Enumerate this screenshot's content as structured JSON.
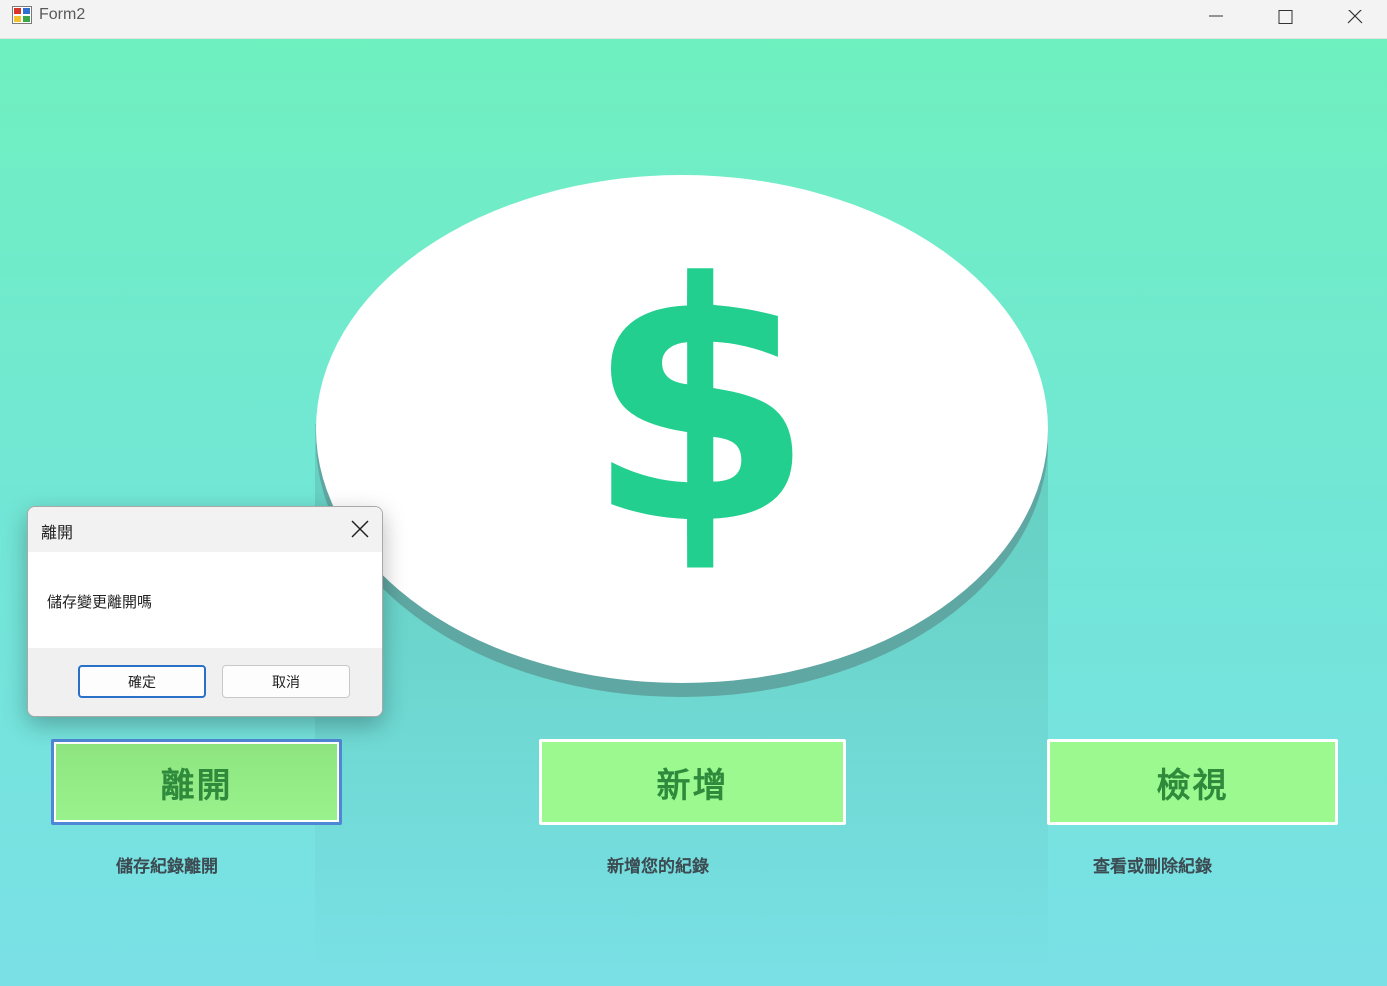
{
  "window": {
    "title": "Form2",
    "icon": "app-icon",
    "controls": [
      "minimize-icon",
      "maximize-icon",
      "close-icon"
    ]
  },
  "hero": {
    "icon": "dollar-sign-icon",
    "symbol": "$",
    "colors": {
      "coin": "#ffffff",
      "symbol": "#22cf8e",
      "coin_edge": "#5fa7a2"
    }
  },
  "buttons": {
    "leave": {
      "label": "離開",
      "caption": "儲存紀錄離開"
    },
    "add": {
      "label": "新增",
      "caption": "新增您的紀錄"
    },
    "view": {
      "label": "檢視",
      "caption": "查看或刪除紀錄"
    }
  },
  "dialog": {
    "title": "離開",
    "message": "儲存變更離開嗎",
    "ok_label": "確定",
    "cancel_label": "取消"
  },
  "colors": {
    "background_top": "#6ff0bf",
    "background_bottom": "#7ae0e6",
    "button_fill": "#9cf98f",
    "button_text": "#2f8a3c",
    "focus_border": "#4f87d6"
  }
}
